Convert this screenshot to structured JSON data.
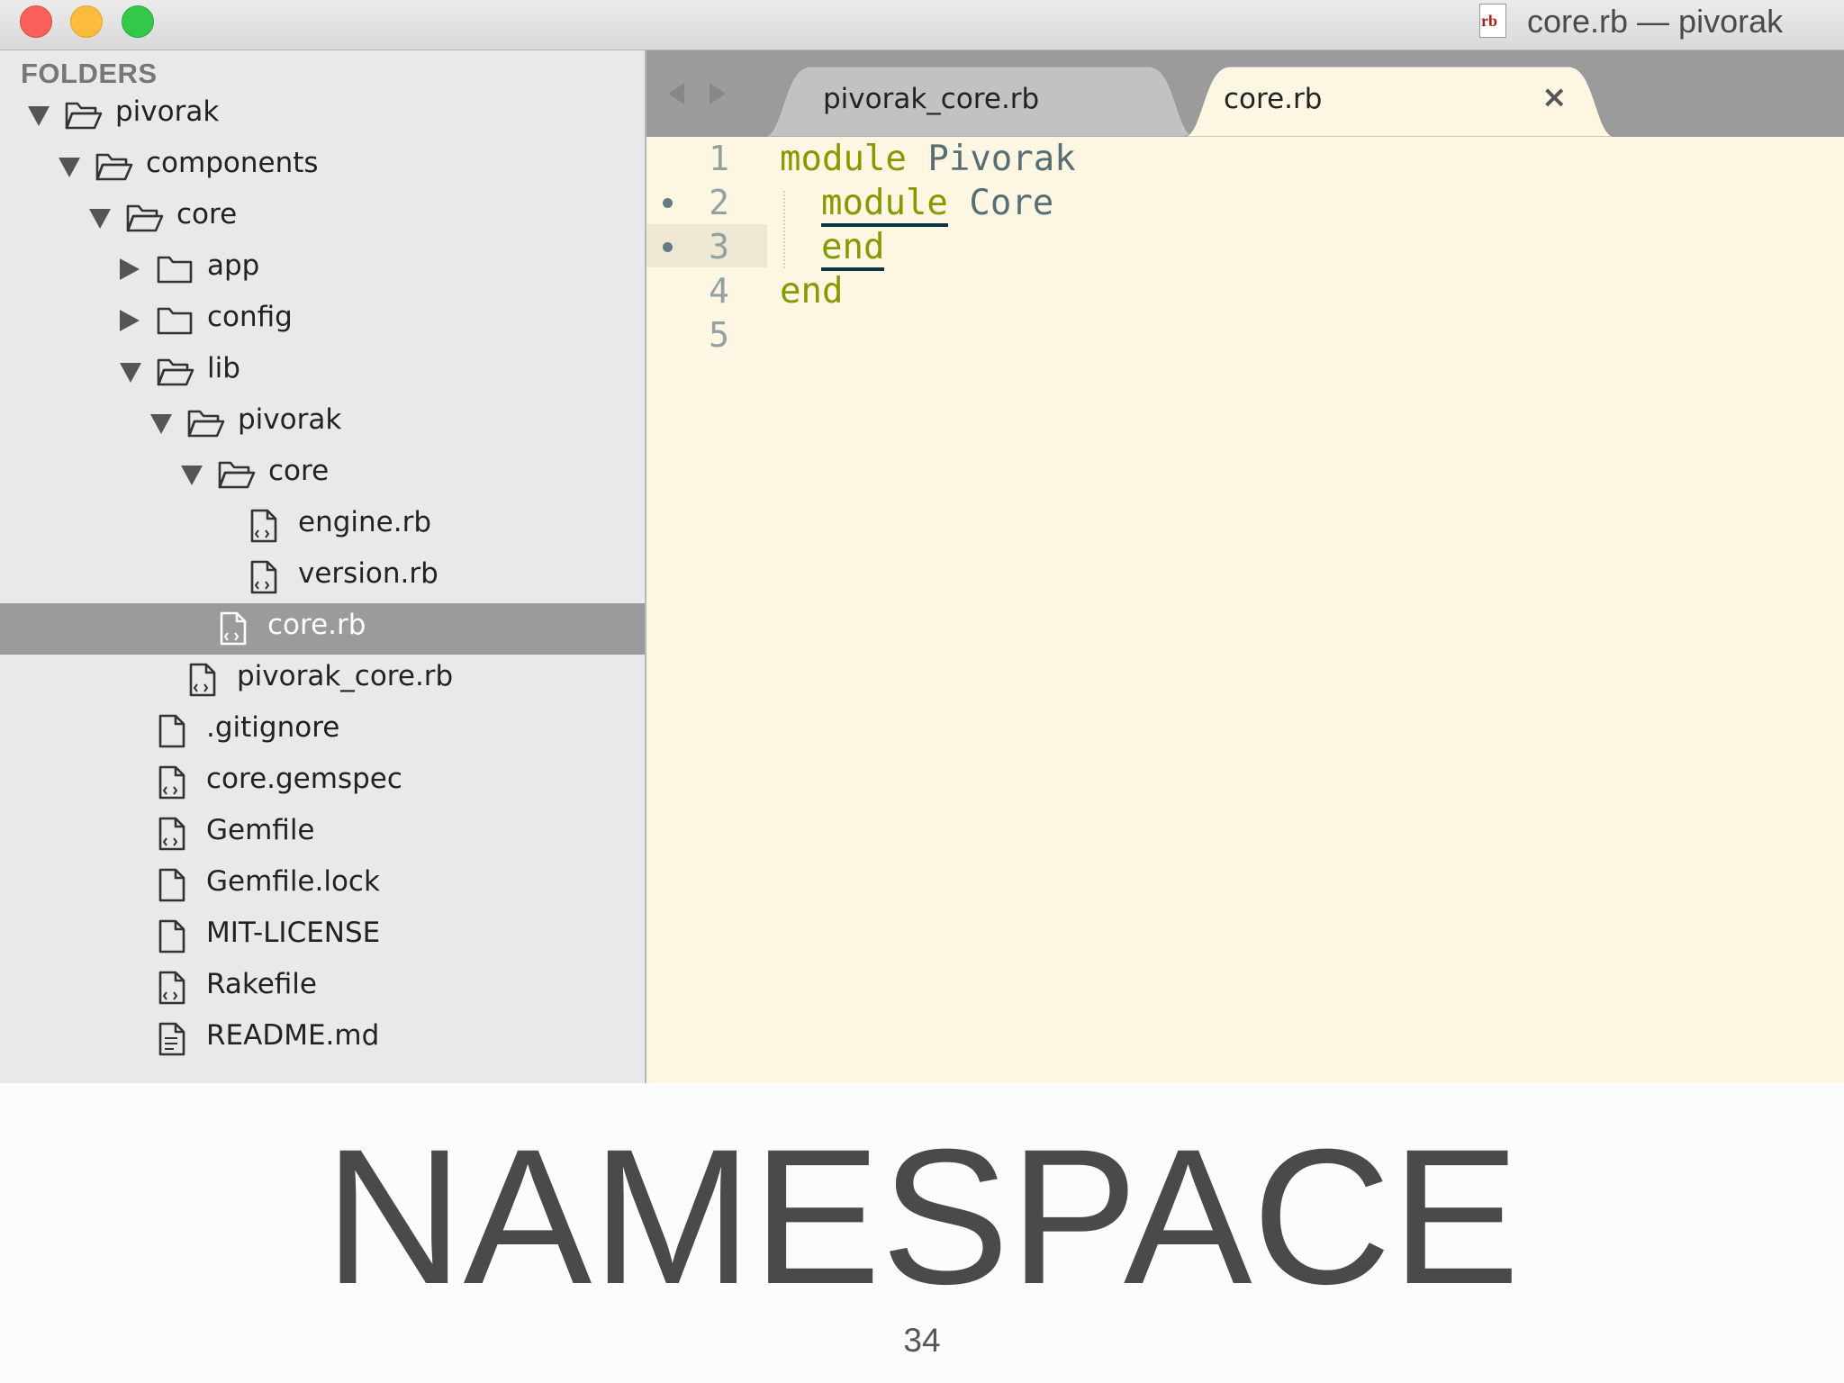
{
  "window": {
    "title": "core.rb — pivorak",
    "title_icon_text": "rb"
  },
  "sidebar": {
    "heading": "FOLDERS",
    "tree": [
      {
        "label": "pivorak",
        "type": "folder",
        "state": "expanded"
      },
      {
        "label": "components",
        "type": "folder",
        "state": "expanded"
      },
      {
        "label": "core",
        "type": "folder",
        "state": "expanded"
      },
      {
        "label": "app",
        "type": "folder",
        "state": "collapsed"
      },
      {
        "label": "config",
        "type": "folder",
        "state": "collapsed"
      },
      {
        "label": "lib",
        "type": "folder",
        "state": "expanded"
      },
      {
        "label": "pivorak",
        "type": "folder",
        "state": "expanded"
      },
      {
        "label": "core",
        "type": "folder",
        "state": "expanded"
      },
      {
        "label": "engine.rb",
        "type": "code-file"
      },
      {
        "label": "version.rb",
        "type": "code-file"
      },
      {
        "label": "core.rb",
        "type": "code-file",
        "selected": true
      },
      {
        "label": "pivorak_core.rb",
        "type": "code-file"
      },
      {
        "label": ".gitignore",
        "type": "file"
      },
      {
        "label": "core.gemspec",
        "type": "code-file"
      },
      {
        "label": "Gemfile",
        "type": "code-file"
      },
      {
        "label": "Gemfile.lock",
        "type": "file"
      },
      {
        "label": "MIT-LICENSE",
        "type": "file"
      },
      {
        "label": "Rakefile",
        "type": "code-file"
      },
      {
        "label": "README.md",
        "type": "text-file"
      }
    ]
  },
  "tabs": [
    {
      "label": "pivorak_core.rb",
      "close": "×",
      "active": false
    },
    {
      "label": "core.rb",
      "close": "×",
      "active": true
    }
  ],
  "editor": {
    "line_numbers": [
      "1",
      "2",
      "3",
      "4",
      "5"
    ],
    "modified_lines": [
      2,
      3
    ],
    "code": [
      {
        "kw": "module",
        "name": " Pivorak"
      },
      {
        "kw": "module",
        "name": " Core"
      },
      {
        "kw": "end",
        "name": ""
      },
      {
        "kw": "end",
        "name": ""
      },
      {
        "kw": "",
        "name": ""
      }
    ],
    "colors": {
      "background": "#fdf6e3",
      "keyword": "#859900",
      "constant": "#586e75"
    }
  },
  "slide": {
    "title": "NAMESPACE",
    "page_number": "34"
  }
}
